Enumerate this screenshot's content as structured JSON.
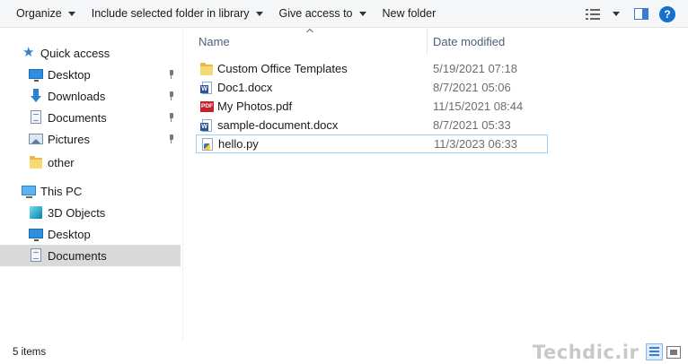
{
  "toolbar": {
    "organize": "Organize",
    "include_library": "Include selected folder in library",
    "give_access": "Give access to",
    "new_folder": "New folder",
    "help": "?"
  },
  "nav": {
    "quick_access": "Quick access",
    "desktop": "Desktop",
    "downloads": "Downloads",
    "documents": "Documents",
    "pictures": "Pictures",
    "other": "other",
    "this_pc": "This PC",
    "objects_3d": "3D Objects",
    "pc_desktop": "Desktop",
    "pc_documents": "Documents"
  },
  "columns": {
    "name": "Name",
    "date_modified": "Date modified"
  },
  "files": [
    {
      "name": "Custom Office Templates",
      "date": "5/19/2021 07:18",
      "icon": "folder-icon"
    },
    {
      "name": "Doc1.docx",
      "date": "8/7/2021 05:06",
      "icon": "word-doc-icon"
    },
    {
      "name": "My Photos.pdf",
      "date": "11/15/2021 08:44",
      "icon": "pdf-icon"
    },
    {
      "name": "sample-document.docx",
      "date": "8/7/2021 05:33",
      "icon": "word-doc-icon"
    },
    {
      "name": "hello.py",
      "date": "11/3/2023 06:33",
      "icon": "python-file-icon"
    }
  ],
  "status": {
    "item_count": "5 items"
  },
  "watermark": "Techdic.ir",
  "colors": {
    "accent": "#1670d0",
    "selected_nav": "#d9d9d9",
    "focus_border": "#99d1ff",
    "date_text": "#6d6d6d",
    "header_text": "#4c607a"
  }
}
